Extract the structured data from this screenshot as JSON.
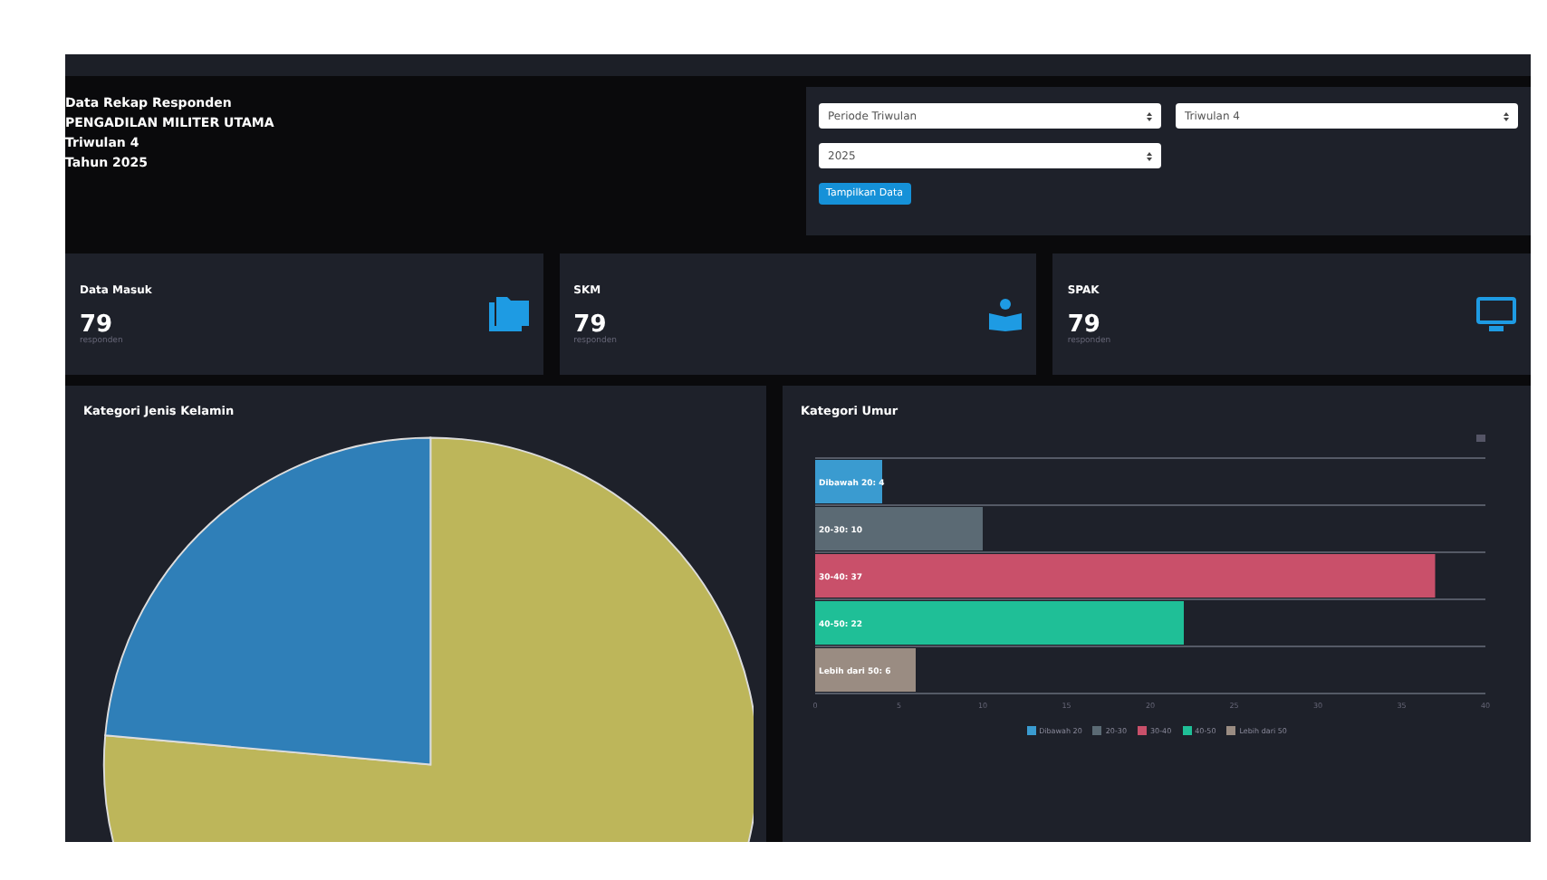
{
  "info": {
    "lines": [
      "Data Rekap Responden",
      "PENGADILAN MILITER UTAMA",
      "Triwulan 4",
      "Tahun 2025"
    ]
  },
  "filters": {
    "selects": [
      {
        "value": "Periode Triwulan"
      },
      {
        "value": "Triwulan 4"
      },
      {
        "value": "2025"
      }
    ],
    "button": "Tampilkan Data"
  },
  "stats": [
    {
      "title": "Data Masuk",
      "value": "79",
      "unit": "responden",
      "kind": "folder"
    },
    {
      "title": "SKM",
      "value": "79",
      "unit": "responden",
      "kind": "book"
    },
    {
      "title": "SPAK",
      "value": "79",
      "unit": "responden",
      "kind": "monitor"
    }
  ],
  "gender_chart": {
    "title": "Kategori Jenis Kelamin"
  },
  "age_chart": {
    "title": "Kategori Umur",
    "legend": [
      {
        "label": "Dibawah 20",
        "color": "#3a9bd0"
      },
      {
        "label": "20-30",
        "color": "#5b6a74"
      },
      {
        "label": "30-40",
        "color": "#c9506a"
      },
      {
        "label": "40-50",
        "color": "#1fbf97"
      },
      {
        "label": "Lebih dari 50",
        "color": "#9a8c82"
      }
    ],
    "chart_data": {
      "type": "bar",
      "orientation": "horizontal",
      "categories": [
        "Dibawah 20: 4",
        "20-30: 10",
        "30-40: 37",
        "40-50: 22",
        "Lebih dari 50: 6"
      ],
      "values": [
        4,
        10,
        37,
        22,
        6
      ],
      "xlim": [
        0,
        40
      ],
      "xticks": [
        0,
        5,
        10,
        15,
        20,
        25,
        30,
        35,
        40
      ]
    }
  }
}
